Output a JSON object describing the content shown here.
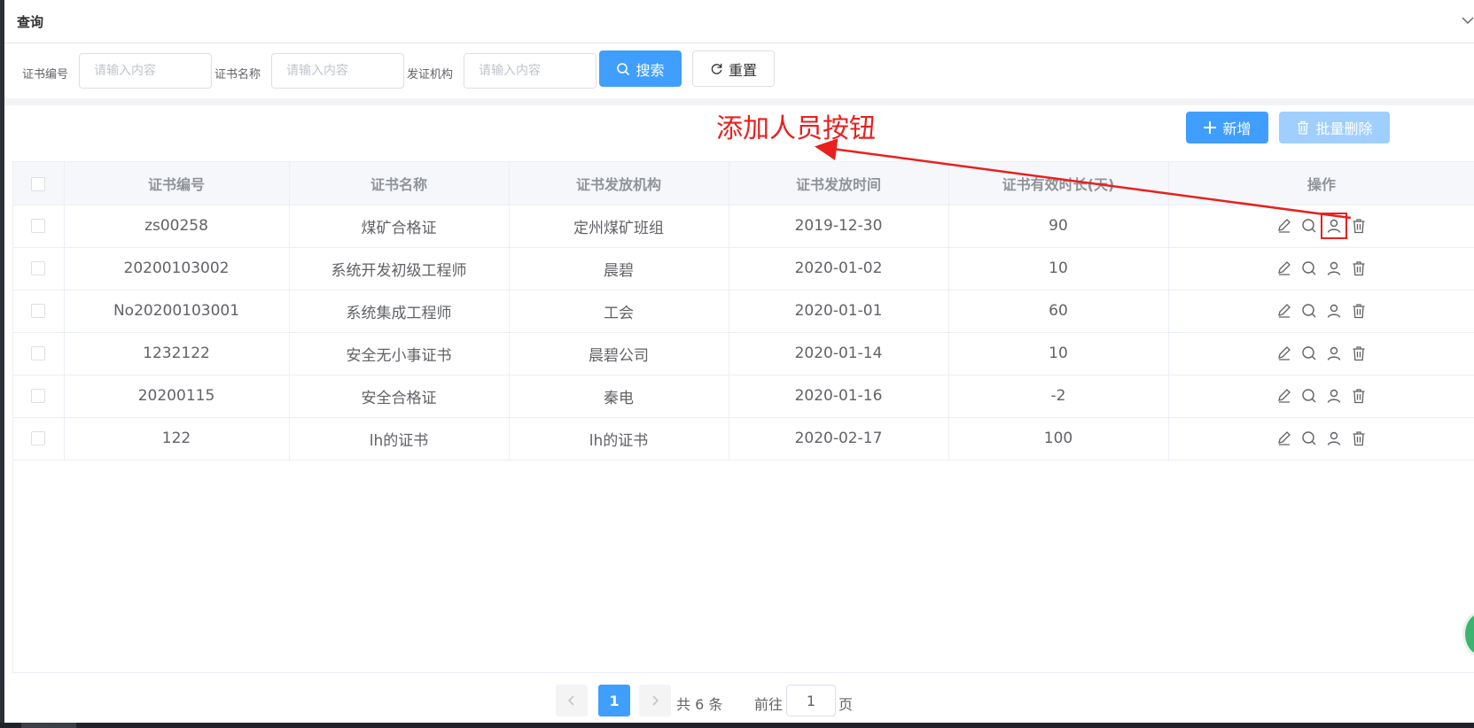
{
  "query": {
    "title": "查询",
    "fields": [
      {
        "label": "证书编号",
        "placeholder": "请输入内容"
      },
      {
        "label": "证书名称",
        "placeholder": "请输入内容"
      },
      {
        "label": "发证机构",
        "placeholder": "请输入内容"
      }
    ],
    "search_label": "搜索",
    "reset_label": "重置"
  },
  "toolbar": {
    "add_label": "新增",
    "batch_delete_label": "批量删除"
  },
  "annotation": {
    "text": "添加人员按钮",
    "color": "#e8201f"
  },
  "table": {
    "headers": [
      "证书编号",
      "证书名称",
      "证书发放机构",
      "证书发放时间",
      "证书有效时长(天)",
      "操作"
    ],
    "rows": [
      {
        "code": "zs00258",
        "name": "煤矿合格证",
        "org": "定州煤矿班组",
        "date": "2019-12-30",
        "days": "90"
      },
      {
        "code": "20200103002",
        "name": "系统开发初级工程师",
        "org": "晨碧",
        "date": "2020-01-02",
        "days": "10"
      },
      {
        "code": "No20200103001",
        "name": "系统集成工程师",
        "org": "工会",
        "date": "2020-01-01",
        "days": "60"
      },
      {
        "code": "1232122",
        "name": "安全无小事证书",
        "org": "晨碧公司",
        "date": "2020-01-14",
        "days": "10"
      },
      {
        "code": "20200115",
        "name": "安全合格证",
        "org": "秦电",
        "date": "2020-01-16",
        "days": "-2"
      },
      {
        "code": "122",
        "name": "lh的证书",
        "org": "lh的证书",
        "date": "2020-02-17",
        "days": "100"
      }
    ],
    "row_actions": [
      "edit-icon",
      "view-icon",
      "add-person-icon",
      "delete-icon"
    ]
  },
  "pagination": {
    "current_page": "1",
    "total_text": "共 6 条",
    "goto_label": "前往",
    "goto_value": "1",
    "page_suffix": "页"
  },
  "colors": {
    "primary": "#409eff",
    "primary_disabled": "#a0cfff",
    "annotation_red": "#e8201f"
  }
}
